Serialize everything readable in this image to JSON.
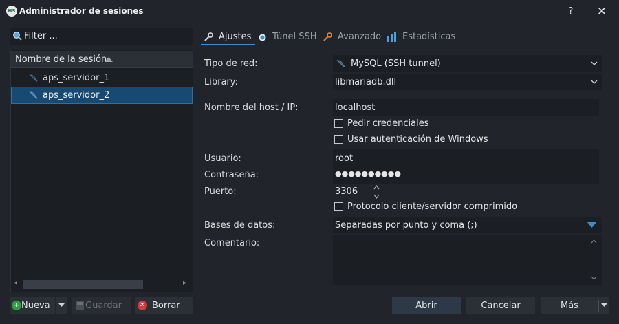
{
  "window": {
    "title": "Administrador de sesiones",
    "logo_text": "HS",
    "help_label": "?",
    "close_label": "✕"
  },
  "filter": {
    "placeholder": "Filter ..."
  },
  "session_tree": {
    "header": "Nombre de la sesión",
    "sessions": [
      {
        "label": "aps_servidor_1",
        "selected": false
      },
      {
        "label": "aps_servidor_2",
        "selected": true
      }
    ]
  },
  "left_buttons": {
    "new_label": "Nueva",
    "save_label": "Guardar",
    "delete_label": "Borrar"
  },
  "tabs": [
    {
      "label": "Ajustes",
      "active": true,
      "icon": "wrench-icon"
    },
    {
      "label": "Túnel SSH",
      "active": false,
      "icon": "ssh-icon"
    },
    {
      "label": "Avanzado",
      "active": false,
      "icon": "wrench-icon"
    },
    {
      "label": "Estadísticas",
      "active": false,
      "icon": "bar-chart-icon"
    }
  ],
  "form": {
    "network_type_label": "Tipo de red:",
    "network_type_value": "MySQL (SSH tunnel)",
    "library_label": "Library:",
    "library_value": "libmariadb.dll",
    "host_label": "Nombre del host / IP:",
    "host_value": "localhost",
    "ask_credentials_label": "Pedir credenciales",
    "windows_auth_label": "Usar autenticación de Windows",
    "user_label": "Usuario:",
    "user_value": "root",
    "password_label": "Contraseña:",
    "password_value": "●●●●●●●●●●",
    "port_label": "Puerto:",
    "port_value": "3306",
    "compressed_label": "Protocolo cliente/servidor comprimido",
    "databases_label": "Bases de datos:",
    "databases_value": "Separadas por punto y coma (;)",
    "comment_label": "Comentario:",
    "comment_value": ""
  },
  "right_buttons": {
    "open_label": "Abrir",
    "cancel_label": "Cancelar",
    "more_label": "Más"
  },
  "colors": {
    "background": "#21252b",
    "field": "#1b1e23",
    "selection": "#164a73",
    "accent": "#3d8cd0"
  }
}
